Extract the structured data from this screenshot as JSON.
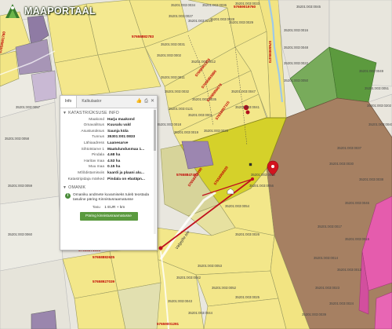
{
  "app": {
    "logo_text": "MAAPORTAAL"
  },
  "panel": {
    "tabs": [
      "Info",
      "Kalkulaator"
    ],
    "section_title": "KATASTRIÜKSUSE INFO",
    "rows": [
      {
        "label": "Maakond",
        "value": "Harju maakond"
      },
      {
        "label": "Omavalitsus",
        "value": "Kuusalu vald"
      },
      {
        "label": "Asustusüksus",
        "value": "Saunja küla"
      },
      {
        "label": "Tunnus",
        "value": "35301:001:0833"
      },
      {
        "label": "Lähiaadress",
        "value": "Laanesarve"
      },
      {
        "label": "Sihtotstarve 1",
        "value": "Maatulundusmaa 1..."
      },
      {
        "label": "Pindala",
        "value": "4.68 ha"
      },
      {
        "label": "Haritav maa",
        "value": "4.53 ha"
      },
      {
        "label": "Muu maa",
        "value": "0.15 ha"
      },
      {
        "label": "Mõõdistamisviis",
        "value": "kaardi ja plaani alu..."
      },
      {
        "label": "Katastripidaja märked",
        "value": "Pindala on ebatäpn..."
      }
    ],
    "owner_title": "OMANIK",
    "owner_note": "Omaniku andmete kuvamiseks tuleb teostada tasuline päring Kinnistusraamatusse",
    "fee_label": "Tasu",
    "fee_value": "1 EUR + km",
    "order_button": "Päring kinnistusraamatusse"
  },
  "map": {
    "road_label": "Valgejõe tee",
    "red_labels": [
      "57658981780",
      "57658882783",
      "57659019760",
      "57659099473",
      "57659961376",
      "57658893890",
      "57658956679",
      "57658957115",
      "57658847491",
      "57658958820",
      "57658973490",
      "57658882625",
      "57658927039",
      "57659001291",
      "57658871005"
    ],
    "parcel_ids": [
      "35201:003:0034",
      "35201:003:0036",
      "35201:003:0033",
      "35201:003:0045",
      "35201:003:0027",
      "35201:003:0210",
      "35201:003:0028",
      "35201:003:0029",
      "35201:003:0031",
      "35201:003:0002",
      "35201:003:0012",
      "35201:003:0011",
      "35201:003:0032",
      "35201:003:0035",
      "35201:003:0121",
      "35201:003:0001",
      "35201:003:0018",
      "35201:003:0019",
      "35201:003:0020",
      "35201:003:0047",
      "35201:003:0041",
      "35201:003:0016",
      "35201:003:0048",
      "35201:003:0022",
      "35201:003:0050",
      "35201:003:0049",
      "35201:003:0051",
      "35201:003:0202",
      "35201:003:0040",
      "35201:003:0037",
      "35201:003:0030",
      "35201:003:0038",
      "35201:003:0046",
      "35201:003:0017",
      "35201:003:0015",
      "35201:003:0014",
      "35201:003:0013",
      "35201:003:0023",
      "35201:003:0024",
      "35201:003:0039",
      "35201:003:0025",
      "35201:003:0052",
      "35201:003:0053",
      "35201:003:0042",
      "35201:003:0043",
      "35201:003:0044",
      "35201:003:0026",
      "35201:003:0054",
      "35201:003:0055",
      "35201:003:0056",
      "35201:003:0057",
      "35201:003:0058",
      "35201:003:0059",
      "35201:003:0060"
    ]
  },
  "colors": {
    "yellow": "#f3e78a",
    "selected": "#d7d32c",
    "brown": "#a57f5c",
    "purple": "#9a86ad",
    "green": "#5d9a3f",
    "pink": "#e65dae",
    "red_line": "#c0101e"
  }
}
